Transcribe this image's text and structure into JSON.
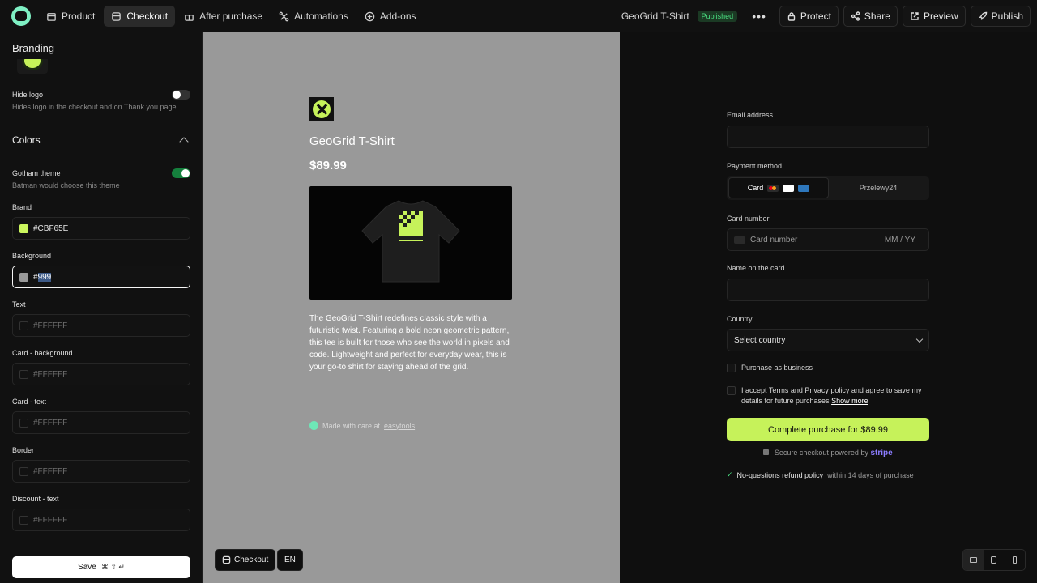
{
  "topbar": {
    "tabs": [
      {
        "label": "Product"
      },
      {
        "label": "Checkout"
      },
      {
        "label": "After purchase"
      },
      {
        "label": "Automations"
      },
      {
        "label": "Add-ons"
      }
    ],
    "product_name": "GeoGrid T-Shirt",
    "status": "Published",
    "more": "•••",
    "buttons": {
      "protect": "Protect",
      "share": "Share",
      "preview": "Preview",
      "publish": "Publish"
    }
  },
  "sidebar": {
    "title": "Branding",
    "hide_logo": {
      "label": "Hide logo",
      "sub": "Hides logo in the checkout and on Thank you page",
      "on": false
    },
    "colors_title": "Colors",
    "gotham": {
      "label": "Gotham theme",
      "sub": "Batman would choose this theme",
      "on": true
    },
    "fields": [
      {
        "label": "Brand",
        "value": "#CBF65E",
        "swatch": "#CBF65E"
      },
      {
        "label": "Background",
        "prefix": "#",
        "selected": "999",
        "swatch": "#999999"
      },
      {
        "label": "Text",
        "value": "#FFFFFF",
        "swatch": "#121212"
      },
      {
        "label": "Card - background",
        "value": "#FFFFFF",
        "swatch": "#121212"
      },
      {
        "label": "Card - text",
        "value": "#FFFFFF",
        "swatch": "#121212"
      },
      {
        "label": "Border",
        "value": "#FFFFFF",
        "swatch": "#121212"
      },
      {
        "label": "Discount - text",
        "value": "#FFFFFF",
        "swatch": "#121212"
      }
    ],
    "save": {
      "label": "Save",
      "shortcut": "⌘ ⇧ ↵"
    }
  },
  "preview": {
    "title": "GeoGrid T-Shirt",
    "price": "$89.99",
    "description": "The GeoGrid T-Shirt redefines classic style with a futuristic twist. Featuring a bold neon geometric pattern, this tee is built for those who see the world in pixels and code. Lightweight and perfect for everyday wear, this is your go-to shirt for staying ahead of the grid.",
    "made_with": "Made with care at",
    "made_link": "easytools",
    "checkout_btn": "Checkout",
    "lang_btn": "EN",
    "background": "#999999",
    "brand": "#CBF65E"
  },
  "form": {
    "email_label": "Email address",
    "email_value": "",
    "payment_label": "Payment method",
    "payment_tabs": [
      "Card",
      "Przelewy24"
    ],
    "card_number_label": "Card number",
    "card_number_placeholder": "Card number",
    "expiry_placeholder": "MM / YY",
    "name_label": "Name on the card",
    "country_label": "Country",
    "country_value": "Select country",
    "business": "Purchase as business",
    "terms": "I accept Terms and Privacy policy and agree to save my details for future purchases",
    "show_more": "Show more",
    "buy_btn": "Complete purchase for $89.99",
    "secure": "Secure checkout powered by",
    "stripe": "stripe",
    "refund_bold": "No-questions refund policy",
    "refund_rest": "within 14 days of purchase"
  }
}
